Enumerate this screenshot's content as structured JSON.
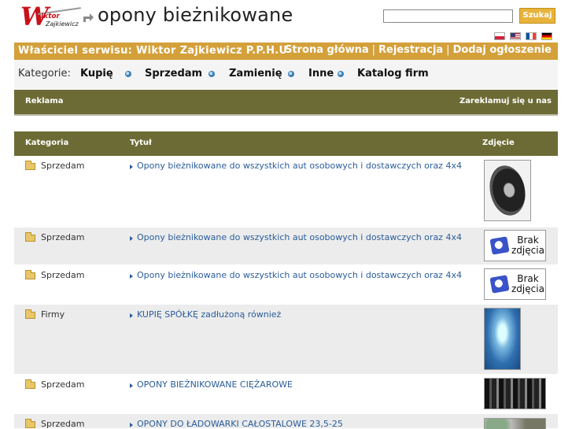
{
  "header": {
    "logo": {
      "line1": "iktor",
      "line2": "Zajkiewicz",
      "letter": "W"
    },
    "site_title": "opony bieżnikowane",
    "search": {
      "placeholder": "",
      "value": "",
      "button_label": "Szukaj"
    },
    "flags": [
      "pl",
      "en",
      "fr",
      "de"
    ]
  },
  "owner_bar": {
    "text": "Właściciel serwisu: Wiktor Zajkiewicz P.P.H.U",
    "nav": [
      "Strona główna",
      "Rejestracja",
      "Dodaj ogłoszenie"
    ],
    "separator": "|"
  },
  "categories": {
    "label": "Kategorie:",
    "items": [
      "Kupię",
      "Sprzedam",
      "Zamienię",
      "Inne",
      "Katalog firm"
    ]
  },
  "ad_bar": {
    "left": "Reklama",
    "right": "Zareklamuj się u nas"
  },
  "table": {
    "headers": [
      "Kategoria",
      "Tytuł",
      "Zdjęcie"
    ],
    "rows": [
      {
        "category": "Sprzedam",
        "title": "Opony bieżnikowane do wszystkich aut osobowych i dostawczych oraz 4x4",
        "photo": "tire"
      },
      {
        "category": "Sprzedam",
        "title": "Opony bieżnikowane do wszystkich aut osobowych i dostawczych oraz 4x4",
        "photo": "brak"
      },
      {
        "category": "Sprzedam",
        "title": "Opony bieżnikowane do wszystkich aut osobowych i dostawczych oraz 4x4",
        "photo": "brak"
      },
      {
        "category": "Firmy",
        "title": "KUPIĘ SPÓŁKĘ zadłużoną również",
        "photo": "blue"
      },
      {
        "category": "Sprzedam",
        "title": "OPONY BIEŻNIKOWANE CIĘŻAROWE",
        "photo": "tires"
      },
      {
        "category": "Sprzedam",
        "title": "OPONY DO ŁADOWARKI CAŁOSTALOWE 23,5-25",
        "photo": "stones"
      }
    ],
    "no_photo_text": [
      "Brak",
      "zdjęcia"
    ]
  },
  "colors": {
    "accent": "#d4a03a",
    "olive": "#6d6b35",
    "link": "#2a5d9a",
    "alt_row": "#ececec"
  }
}
